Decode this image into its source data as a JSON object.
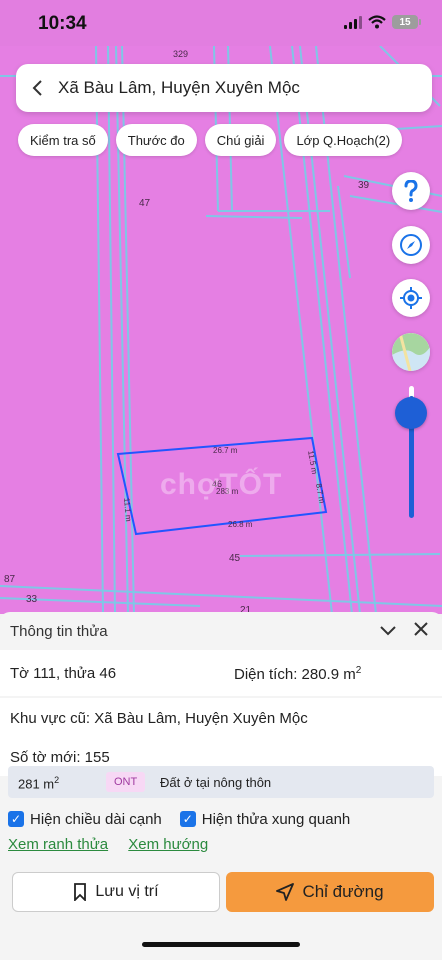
{
  "status": {
    "time": "10:34",
    "battery": "15"
  },
  "search": {
    "query": "Xã Bàu Lâm, Huyện Xuyên Mộc"
  },
  "chips": [
    "Kiểm tra số",
    "Thước đo",
    "Chú giải",
    "Lớp Q.Hoạch(2)"
  ],
  "map": {
    "parcel_labels": [
      "329",
      "47",
      "39",
      "45",
      "87",
      "33",
      "21"
    ],
    "selected": {
      "id": "46",
      "area": "283 m",
      "top": "26.7 m",
      "bottom": "26.8 m",
      "left": "11.1 m",
      "right_top": "11.5 m",
      "right_bottom": "8.7 m"
    },
    "watermark": "chợTỐT",
    "colors": {
      "map": "#e57fe3",
      "lines": "#7fc7e6",
      "selected": "#2255ff"
    }
  },
  "panel": {
    "title": "Thông tin thửa",
    "sheet_parcel": "Tờ 111, thửa 46",
    "area_label": "Diện tích: 280.9 m",
    "area_sup": "2",
    "old_area": "Khu vực cũ: Xã Bàu Lâm, Huyện Xuyên Mộc",
    "new_sheet": "Số tờ mới: 155",
    "land": {
      "area": "281 m",
      "sup": "2",
      "code": "ONT",
      "desc": "Đất ở tại nông thôn"
    },
    "checkbox1": "Hiện chiều dài cạnh",
    "checkbox2": "Hiện thửa xung quanh",
    "link1": "Xem ranh thửa",
    "link2": "Xem hướng",
    "save": "Lưu vị trí",
    "directions": "Chỉ đường"
  },
  "accent": "#f59a3e"
}
